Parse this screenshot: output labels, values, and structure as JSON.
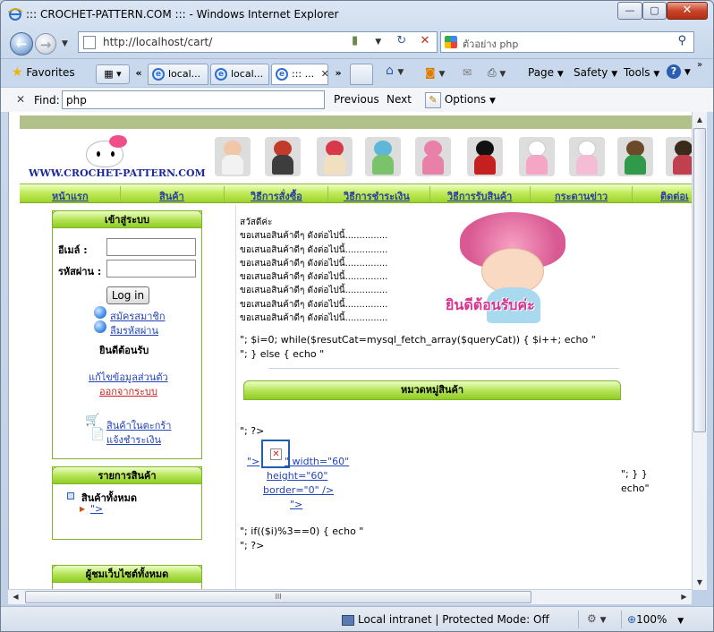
{
  "window": {
    "title": "::: CROCHET-PATTERN.COM ::: - Windows Internet Explorer",
    "min": "—",
    "max": "▢",
    "close": "✕"
  },
  "address": {
    "url": "http://localhost/cart/",
    "search_text": "ตัวอย่าง php",
    "back": "←",
    "forward": "→",
    "refresh": "↻",
    "stop": "✕"
  },
  "commandbar": {
    "favorites": "Favorites",
    "tabs": [
      "local...",
      "local...",
      "::: ..."
    ],
    "tab_close": "✕",
    "chev_left": "«",
    "chev_right": "»",
    "page": "Page",
    "safety": "Safety",
    "tools": "Tools",
    "help": "?"
  },
  "find": {
    "close": "✕",
    "label": "Find:",
    "value": "php",
    "previous": "Previous",
    "next": "Next",
    "options": "Options"
  },
  "site": {
    "logo_text": "WWW.CROCHET-PATTERN.COM",
    "nav": [
      "หน้าแรก",
      "สินค้า",
      "วิธีการสั่งซื้อ",
      "วิธีการชำระเงิน",
      "วิธีการรับสินค้า",
      "กระดานข่าว",
      "ติดต่อเ"
    ],
    "login": {
      "title": "เข้าสู่ระบบ",
      "email_label": "อีเมล์ :",
      "password_label": "รหัสผ่าน :",
      "button": "Log in",
      "register": "สมัครสมาชิก",
      "forgot": "ลืมรหัสผ่าน",
      "welcome": "ยินดีต้อนรับ",
      "edit_profile": "แก้ไขข้อมูลส่วนตัว",
      "logout": "ออกจากระบบ",
      "cart": "สินค้าในตะกร้า",
      "payment": "แจ้งชำระเงิน"
    },
    "products": {
      "title": "รายการสินค้า",
      "all": "สินค้าทั้งหมด",
      "item": "\">"
    },
    "visitors": {
      "title": "ผู้ชมเว็บไซต์ทั้งหมด"
    },
    "intro": {
      "greeting": "สวัสดีค่ะ",
      "lines": [
        "ขอเสนอสินค้าดีๆ ดังต่อไปนี้...............",
        "ขอเสนอสินค้าดีๆ ดังต่อไปนี้...............",
        "ขอเสนอสินค้าดีๆ ดังต่อไปนี้...............",
        "ขอเสนอสินค้าดีๆ ดังต่อไปนี้...............",
        "ขอเสนอสินค้าดีๆ ดังต่อไปนี้...............",
        "ขอเสนอสินค้าดีๆ ดังต่อไปนี้...............",
        "ขอเสนอสินค้าดีๆ ดังต่อไปนี้..............."
      ]
    },
    "banner_text": "ยินดีต้อนรับค่ะ",
    "code1": "\"; $i=0; while($resutCat=mysql_fetch_array($queryCat)) { $i++; echo \"",
    "code2": "\"; } else { echo \"",
    "category_title": "หมวดหมู่สินค้า",
    "code3": "\"; ?>",
    "img_link1": "\">",
    "img_attr1": "\" width=\"60\"",
    "img_attr2": "height=\"60\"",
    "img_attr3": "border=\"0\" />",
    "img_link2": "\">",
    "code4": "\"; if(($i)%3==0) { echo \"",
    "code5": "\"; ?>",
    "right_code1": "\"; } }",
    "right_code2": "echo\""
  },
  "status": {
    "zone": "Local intranet | Protected Mode: Off",
    "zoom": "100%"
  },
  "colors": {
    "nav_green": "#9fd32a",
    "top_band": "#b2c08a",
    "link": "#2244bb",
    "logout_red": "#cc2020",
    "banner_pink": "#d8338f"
  }
}
